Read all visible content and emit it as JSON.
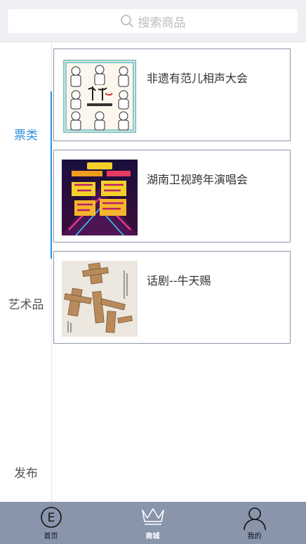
{
  "search": {
    "placeholder": "搜索商品"
  },
  "sidebar": {
    "items": [
      {
        "label": "票类",
        "active": true
      },
      {
        "label": "艺术品",
        "active": false
      },
      {
        "label": "发布",
        "active": false
      }
    ]
  },
  "products": [
    {
      "title": "非遗有范儿相声大会",
      "image": "crosstalk-poster"
    },
    {
      "title": "湖南卫视跨年演唱会",
      "image": "concert-poster"
    },
    {
      "title": "话剧--牛天赐",
      "image": "drama-poster"
    }
  ],
  "tabbar": {
    "items": [
      {
        "label": "首页",
        "icon": "home-e-icon"
      },
      {
        "label": "商城",
        "icon": "crown-icon",
        "active": true
      },
      {
        "label": "我的",
        "icon": "user-icon"
      }
    ]
  },
  "colors": {
    "accent": "#2b8fe0",
    "tabbar": "#8895aa",
    "card_border": "#8a96ab"
  }
}
